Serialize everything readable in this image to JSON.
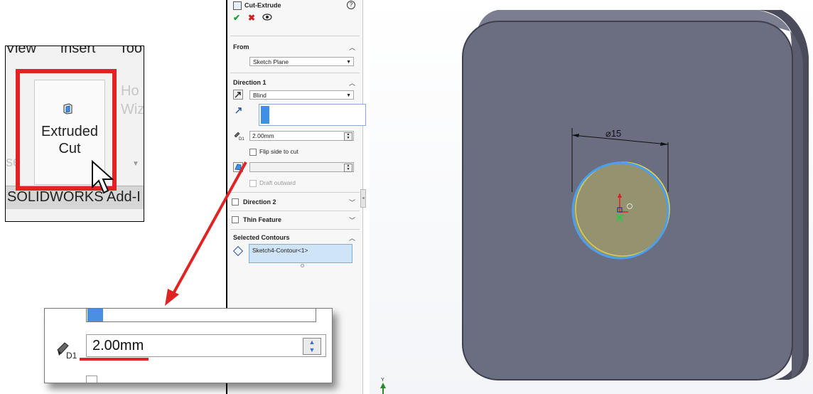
{
  "ribbon": {
    "menu_items": [
      "View",
      "Insert",
      "Too"
    ],
    "extruded_cut_label_line1": "Extruded",
    "extruded_cut_label_line2": "Cut",
    "next_button_partial_line1": "Ho",
    "next_button_partial_line2": "Wiza",
    "left_partial_text": "se",
    "tab_label": "SOLIDWORKS Add-I",
    "highlight_color": "#e02424"
  },
  "property_manager": {
    "title": "Cut-Extrude",
    "help_icon": "?",
    "ok_icon": "✔",
    "cancel_icon": "✖",
    "sections": {
      "from": {
        "label": "From",
        "value": "Sketch Plane"
      },
      "direction1": {
        "label": "Direction 1",
        "end_condition": "Blind",
        "depth": "2.00mm",
        "flip_side_label": "Flip side to cut",
        "draft_outward_label": "Draft outward"
      },
      "direction2": {
        "label": "Direction 2"
      },
      "thin_feature": {
        "label": "Thin Feature"
      },
      "selected_contours": {
        "label": "Selected Contours",
        "items": [
          "Sketch4-Contour<1>"
        ]
      }
    }
  },
  "zoom_callout": {
    "depth_value": "2.00mm",
    "dimension_icon_label": "D1"
  },
  "viewport": {
    "dimension_label": "⌀15",
    "accent_blue": "#3f8fe6",
    "sketch_yellow": "#e8d84a",
    "part_color": "#6b6e80",
    "triad_y_label": "Y"
  }
}
